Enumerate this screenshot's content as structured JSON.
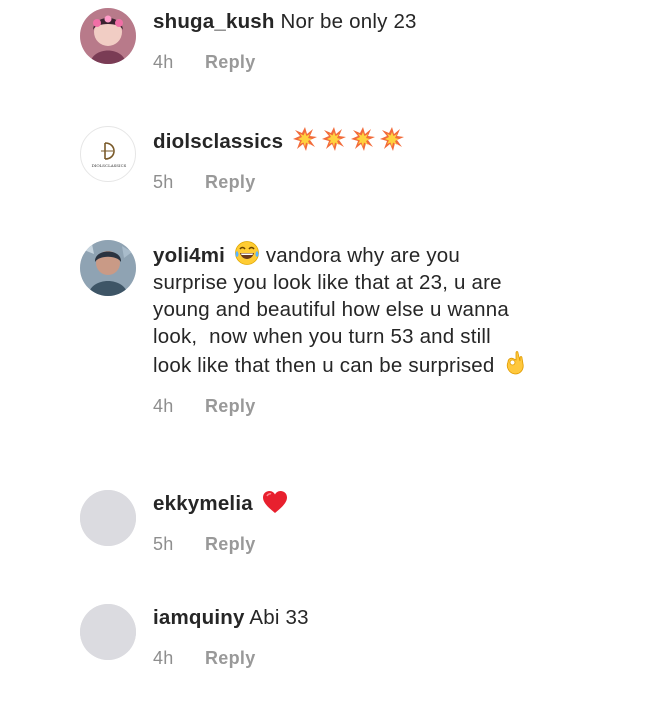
{
  "comments": [
    {
      "username": "shuga_kush",
      "text": "Nor be only 23",
      "time": "4h",
      "reply_label": "Reply",
      "avatar_icon": "photo-avatar-pink"
    },
    {
      "username": "diolsclassics",
      "text": "",
      "emojis": [
        "collision-emoji",
        "collision-emoji",
        "collision-emoji",
        "collision-emoji"
      ],
      "time": "5h",
      "reply_label": "Reply",
      "avatar_icon": "brand-logo-avatar",
      "avatar_logo_text": "DIOLSCLASSICS"
    },
    {
      "username": "yoli4mi",
      "emoji_lead": "joy-emoji",
      "text": "vandora why are you surprise you look like that at 23, u are young and beautiful how else u wanna look,  now when you turn 53 and still look like that then u can be surprised",
      "emoji_trail": "ok-hand-emoji",
      "time": "4h",
      "reply_label": "Reply",
      "avatar_icon": "photo-avatar-blue"
    },
    {
      "username": "ekkymelia",
      "text": "",
      "emojis": [
        "red-heart-emoji"
      ],
      "time": "5h",
      "reply_label": "Reply",
      "avatar_icon": "default-avatar"
    },
    {
      "username": "iamquiny",
      "text": "Abi 33",
      "time": "4h",
      "reply_label": "Reply",
      "avatar_icon": "default-avatar"
    }
  ],
  "colors": {
    "text": "#262626",
    "meta": "#8e8e8e",
    "avatar_placeholder": "#dbdbe0"
  }
}
